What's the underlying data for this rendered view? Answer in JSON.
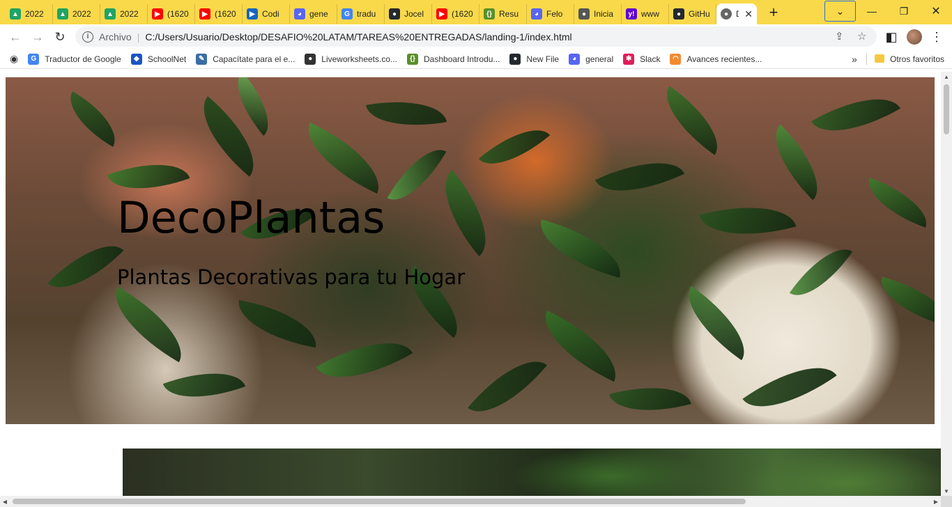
{
  "browser": {
    "tabs": [
      {
        "label": "2022",
        "icon": "google-drive-icon",
        "color": "#1fa463"
      },
      {
        "label": "2022",
        "icon": "google-drive-icon",
        "color": "#1fa463"
      },
      {
        "label": "2022",
        "icon": "google-drive-icon",
        "color": "#1fa463"
      },
      {
        "label": "(1620",
        "icon": "youtube-icon",
        "color": "#ff0000"
      },
      {
        "label": "(1620",
        "icon": "youtube-icon",
        "color": "#ff0000"
      },
      {
        "label": "Codi",
        "icon": "codi-icon",
        "color": "#1565c0"
      },
      {
        "label": "gene",
        "icon": "discord-icon",
        "color": "#5865f2"
      },
      {
        "label": "tradu",
        "icon": "google-icon",
        "color": "#4285f4"
      },
      {
        "label": "Jocel",
        "icon": "github-icon",
        "color": "#24292f"
      },
      {
        "label": "(1620",
        "icon": "youtube-icon",
        "color": "#ff0000"
      },
      {
        "label": "Resu",
        "icon": "notion-icon",
        "color": "#5a8f29"
      },
      {
        "label": "Felo",
        "icon": "discord-icon",
        "color": "#5865f2"
      },
      {
        "label": "Inicia",
        "icon": "globe-icon",
        "color": "#555555"
      },
      {
        "label": "www",
        "icon": "yahoo-icon",
        "color": "#6001d2"
      },
      {
        "label": "GitHu",
        "icon": "github-icon",
        "color": "#24292f"
      }
    ],
    "active_tab": {
      "label": "D",
      "icon": "globe-icon"
    },
    "new_tab_label": "+",
    "address": {
      "chip": "Archivo",
      "url": "C:/Users/Usuario/Desktop/DESAFIO%20LATAM/TAREAS%20ENTREGADAS/landing-1/index.html"
    },
    "bookmarks": [
      {
        "label": "Traductor de Google",
        "icon": "google-translate-icon",
        "color": "#4285f4"
      },
      {
        "label": "SchoolNet",
        "icon": "schoolnet-icon",
        "color": "#1a56c4"
      },
      {
        "label": "Capacítate para el e...",
        "icon": "edit-icon",
        "color": "#3a6ea5"
      },
      {
        "label": "Liveworksheets.co...",
        "icon": "globe-icon",
        "color": "#333333"
      },
      {
        "label": "Dashboard Introdu...",
        "icon": "notion-icon",
        "color": "#5a8f29"
      },
      {
        "label": "New File",
        "icon": "github-icon",
        "color": "#24292f"
      },
      {
        "label": "general",
        "icon": "discord-icon",
        "color": "#5865f2"
      },
      {
        "label": "Slack",
        "icon": "slack-icon",
        "color": "#e01e5a"
      },
      {
        "label": "Avances recientes...",
        "icon": "rainbow-icon",
        "color": "#f28b30"
      }
    ],
    "more_bookmarks_label": "»",
    "other_favorites_label": "Otros favoritos",
    "accent_color": "#f9d94a"
  },
  "page": {
    "hero_title": "DecoPlantas",
    "hero_subtitle": "Plantas Decorativas para tu Hogar"
  }
}
